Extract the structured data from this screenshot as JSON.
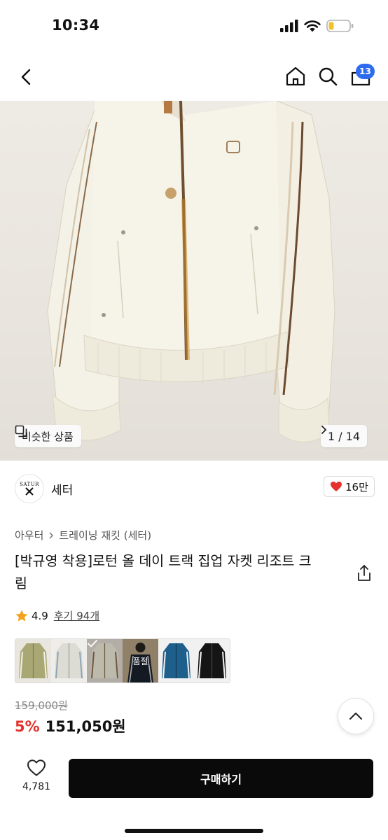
{
  "status_bar": {
    "time": "10:34"
  },
  "nav": {
    "cart_count": "13"
  },
  "hero": {
    "similar_label": "비슷한 상품",
    "pager": "1 / 14"
  },
  "brand": {
    "logo_text": "SATUR",
    "name": "세터",
    "likes": "16만"
  },
  "breadcrumb": {
    "category": "아우터",
    "subcategory": "트레이닝 재킷 (세터)"
  },
  "product": {
    "title_line1": "[박규영 착용]로턴 올 데이 트랙 집업 자켓 리조트 크",
    "title_line2": "림",
    "rating": "4.9",
    "reviews": "후기 94개",
    "sold_out_label": "품절",
    "original_price": "159,000원",
    "discount": "5%",
    "price": "151,050원"
  },
  "swatches": [
    {
      "color": "#a9a874",
      "trim": "#f2f2ea"
    },
    {
      "color": "#dcdcd4",
      "trim": "#8fa6b8"
    },
    {
      "color": "#e6e2d4",
      "trim": "#8a6a4a",
      "selected": true
    },
    {
      "color": "#1d2433",
      "trim": "#f3f3f3",
      "sold_out": true
    },
    {
      "color": "#1f5f8c",
      "trim": "#f3f3f3"
    },
    {
      "color": "#151515",
      "trim": "#f3f3f3"
    }
  ],
  "bottom": {
    "wish_count": "4,781",
    "buy_label": "구매하기"
  },
  "colors": {
    "accent_red": "#e5322d",
    "badge_blue": "#2d6bf0",
    "buy_bg": "#0a0a0a"
  }
}
